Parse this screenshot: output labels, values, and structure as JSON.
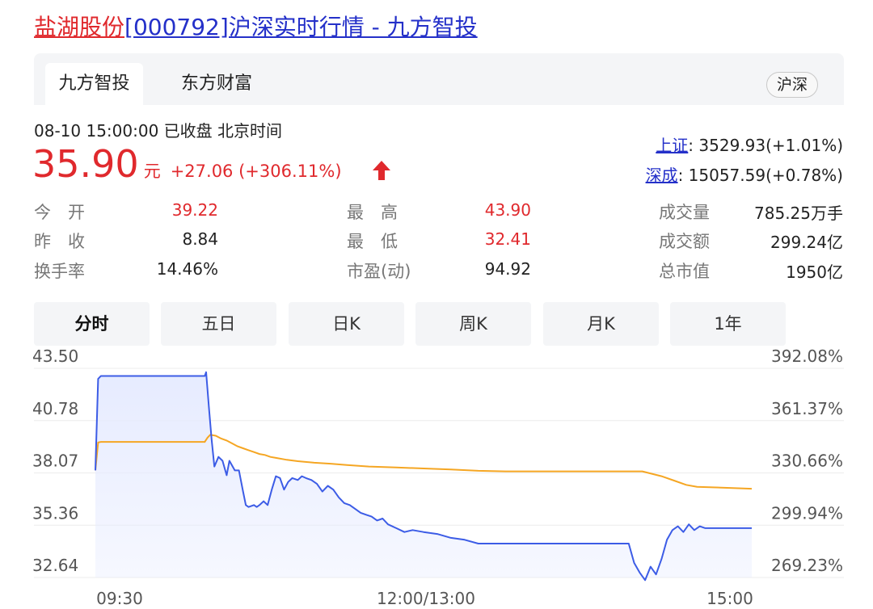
{
  "page_title": {
    "name_link": "盐湖股份",
    "code_link": "[000792]沪深实时行情 - 九方智投"
  },
  "tabs": [
    {
      "label": "九方智投",
      "active": true
    },
    {
      "label": "东方财富",
      "active": false
    }
  ],
  "market_badge": "沪深",
  "quote": {
    "time_status": "08-10 15:00:00  已收盘  北京时间",
    "price": "35.90",
    "unit": "元",
    "change": "+27.06 (+306.11%)",
    "direction": "up",
    "up_color": "#e0292d"
  },
  "indices": [
    {
      "name": "上证",
      "value": ": 3529.93(+1.01%)"
    },
    {
      "name": "深成",
      "value": ": 15057.59(+0.78%)"
    }
  ],
  "stats": {
    "open": {
      "label": "今　开",
      "value": "39.22"
    },
    "prev_close": {
      "label": "昨　收",
      "value": "8.84"
    },
    "turnover_rate": {
      "label": "换手率",
      "value": "14.46%"
    },
    "high": {
      "label": "最　高",
      "value": "43.90"
    },
    "low": {
      "label": "最　低",
      "value": "32.41"
    },
    "pe_dynamic": {
      "label": "市盈(动)",
      "value": "94.92"
    },
    "volume": {
      "label": "成交量",
      "value": "785.25万手"
    },
    "amount": {
      "label": "成交额",
      "value": "299.24亿"
    },
    "market_cap": {
      "label": "总市值",
      "value": "1950亿"
    }
  },
  "period_tabs": [
    {
      "label": "分时",
      "selected": true
    },
    {
      "label": "五日",
      "selected": false
    },
    {
      "label": "日K",
      "selected": false
    },
    {
      "label": "周K",
      "selected": false
    },
    {
      "label": "月K",
      "selected": false
    },
    {
      "label": "1年",
      "selected": false
    }
  ],
  "chart_data": {
    "type": "line",
    "price_ticks": [
      "43.50",
      "40.78",
      "38.07",
      "35.36",
      "32.64"
    ],
    "percent_ticks": [
      "392.08%",
      "361.37%",
      "330.66%",
      "299.94%",
      "269.23%"
    ],
    "x_ticks": [
      "09:30",
      "12:00/13:00",
      "15:00"
    ],
    "ylim": [
      32.64,
      43.5
    ],
    "x_range_minutes": [
      0,
      240
    ],
    "price_color": "#3c5ce6",
    "avg_color": "#f5a623",
    "area_fill": "#e6ebff",
    "series": [
      {
        "key": "price",
        "x": [
          0,
          1,
          2,
          40,
          40.5,
          41.5,
          42.5,
          43.5,
          45,
          46.5,
          48,
          49,
          51,
          52.5,
          54,
          55,
          56,
          58,
          59,
          60,
          61.5,
          63,
          64.5,
          66,
          67.5,
          69,
          70.5,
          72,
          74,
          75.5,
          77,
          79,
          81,
          83,
          85,
          87,
          89,
          91,
          93,
          95,
          97,
          99,
          101,
          103,
          105,
          107,
          110,
          113,
          116,
          120,
          125,
          130,
          135,
          140,
          150,
          160,
          170,
          180,
          190,
          195,
          197,
          199,
          201,
          203,
          205,
          207,
          209,
          211,
          213,
          215,
          217,
          219,
          221,
          223,
          225,
          227,
          230,
          235,
          240
        ],
        "y": [
          38.2,
          42.95,
          43.1,
          43.1,
          43.3,
          41.5,
          39.8,
          38.4,
          38.9,
          38.7,
          37.95,
          38.7,
          38.2,
          38.2,
          37.1,
          36.4,
          36.3,
          36.4,
          36.3,
          36.4,
          36.6,
          36.4,
          37.2,
          37.9,
          37.8,
          37.2,
          37.6,
          37.8,
          37.7,
          37.9,
          37.8,
          37.7,
          37.5,
          37.1,
          37.4,
          37.2,
          36.8,
          36.5,
          36.4,
          36.2,
          36.0,
          35.9,
          35.8,
          35.6,
          35.7,
          35.4,
          35.2,
          35.0,
          35.1,
          35.0,
          34.9,
          34.7,
          34.6,
          34.4,
          34.4,
          34.4,
          34.4,
          34.4,
          34.4,
          34.4,
          33.4,
          32.9,
          32.5,
          33.2,
          32.8,
          33.6,
          34.6,
          35.1,
          35.3,
          35.0,
          35.4,
          35.1,
          35.3,
          35.2,
          35.2,
          35.2,
          35.2,
          35.2,
          35.2
        ]
      },
      {
        "key": "average",
        "x": [
          0,
          1,
          2,
          30,
          40,
          41,
          42,
          44,
          46,
          48,
          50,
          52,
          54,
          56,
          58,
          60,
          62,
          64,
          66,
          70,
          74,
          80,
          86,
          92,
          100,
          110,
          120,
          130,
          140,
          150,
          160,
          180,
          200,
          207,
          212,
          216,
          220,
          230,
          240
        ],
        "y": [
          38.2,
          39.65,
          39.68,
          39.68,
          39.68,
          39.9,
          40.05,
          40.0,
          39.85,
          39.75,
          39.6,
          39.45,
          39.35,
          39.25,
          39.15,
          39.05,
          39.0,
          38.9,
          38.85,
          38.75,
          38.68,
          38.6,
          38.55,
          38.48,
          38.4,
          38.35,
          38.3,
          38.25,
          38.18,
          38.15,
          38.15,
          38.15,
          38.15,
          37.9,
          37.65,
          37.45,
          37.35,
          37.3,
          37.25
        ]
      }
    ]
  }
}
